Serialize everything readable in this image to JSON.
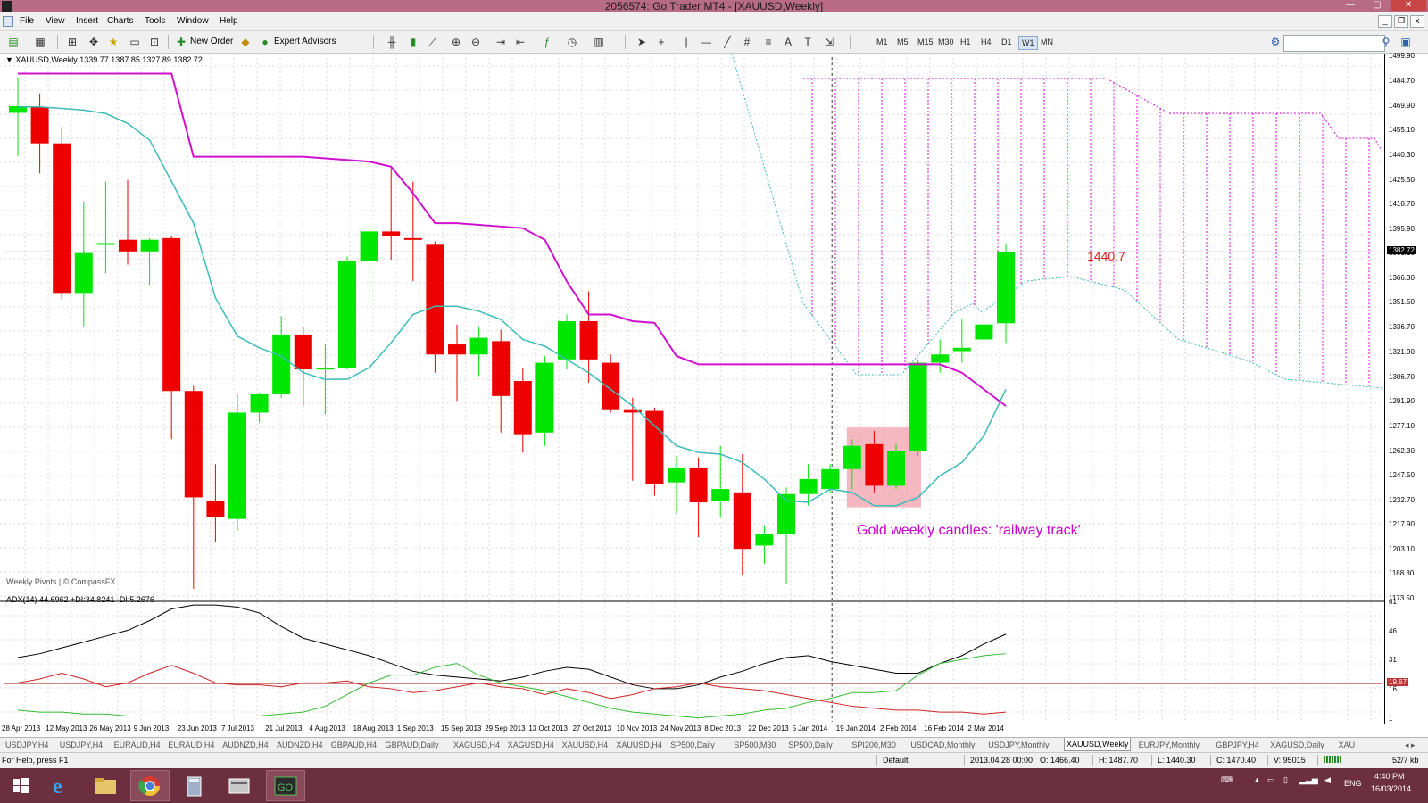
{
  "window": {
    "title": "2056574: Go Trader MT4 - [XAUUSD,Weekly]",
    "min_label": "—",
    "max_label": "▢",
    "close_label": "✕"
  },
  "menu": [
    "File",
    "View",
    "Insert",
    "Charts",
    "Tools",
    "Window",
    "Help"
  ],
  "toolbar": {
    "new_order": "New Order",
    "expert_advisors": "Expert Advisors",
    "timeframes": [
      "M1",
      "M5",
      "M15",
      "M30",
      "H1",
      "H4",
      "D1",
      "W1",
      "MN"
    ],
    "active_timeframe": "W1",
    "search_placeholder": ""
  },
  "chart": {
    "header": "XAUUSD,Weekly  1339.77 1387.85 1327.89 1382.72",
    "indicator_note": "Weekly Pivots | © CompassFX",
    "annotation": "Gold weekly candles: 'railway track'",
    "price_tag": "1440.7",
    "adx_header": "ADX(14) 44.6962 +DI:34.8241 -DI:5.2676",
    "current_price_label": "1382.72",
    "adx_current_label": "19.67"
  },
  "chart_data": {
    "type": "candlestick",
    "symbol": "XAUUSD",
    "timeframe": "Weekly",
    "ylim": [
      1173.5,
      1499.9
    ],
    "y_ticks": [
      "1499.90",
      "1484.70",
      "1469.90",
      "1455.10",
      "1440.30",
      "1425.50",
      "1410.70",
      "1395.90",
      "1381.10",
      "1366.30",
      "1351.50",
      "1336.70",
      "1321.90",
      "1306.70",
      "1291.90",
      "1277.10",
      "1262.30",
      "1247.50",
      "1232.70",
      "1217.90",
      "1203.10",
      "1188.30",
      "1173.50"
    ],
    "x_ticks": [
      "28 Apr 2013",
      "12 May 2013",
      "26 May 2013",
      "9 Jun 2013",
      "23 Jun 2013",
      "7 Jul 2013",
      "21 Jul 2013",
      "4 Aug 2013",
      "18 Aug 2013",
      "1 Sep 2013",
      "15 Sep 2013",
      "29 Sep 2013",
      "13 Oct 2013",
      "27 Oct 2013",
      "10 Nov 2013",
      "24 Nov 2013",
      "8 Dec 2013",
      "22 Dec 2013",
      "5 Jan 2014",
      "19 Jan 2014",
      "2 Feb 2014",
      "16 Feb 2014",
      "2 Mar 2014"
    ],
    "candles": [
      {
        "o": 1466.4,
        "h": 1487.7,
        "l": 1440.3,
        "c": 1470.4
      },
      {
        "o": 1469.9,
        "h": 1478.0,
        "l": 1430.0,
        "c": 1448.0
      },
      {
        "o": 1448.0,
        "h": 1458.0,
        "l": 1354.0,
        "c": 1358.0
      },
      {
        "o": 1358.0,
        "h": 1413.0,
        "l": 1338.0,
        "c": 1382.0
      },
      {
        "o": 1387.0,
        "h": 1425.0,
        "l": 1370.0,
        "c": 1388.0
      },
      {
        "o": 1390.0,
        "h": 1426.0,
        "l": 1375.0,
        "c": 1383.0
      },
      {
        "o": 1383.0,
        "h": 1391.0,
        "l": 1363.0,
        "c": 1390.0
      },
      {
        "o": 1391.0,
        "h": 1392.0,
        "l": 1270.0,
        "c": 1299.0
      },
      {
        "o": 1299.0,
        "h": 1302.0,
        "l": 1180.0,
        "c": 1235.0
      },
      {
        "o": 1233.0,
        "h": 1255.0,
        "l": 1208.0,
        "c": 1223.0
      },
      {
        "o": 1222.0,
        "h": 1297.0,
        "l": 1215.0,
        "c": 1286.0
      },
      {
        "o": 1286.0,
        "h": 1298.0,
        "l": 1280.0,
        "c": 1297.0
      },
      {
        "o": 1297.0,
        "h": 1344.0,
        "l": 1295.0,
        "c": 1333.0
      },
      {
        "o": 1333.0,
        "h": 1338.0,
        "l": 1290.0,
        "c": 1312.0
      },
      {
        "o": 1312.0,
        "h": 1327.0,
        "l": 1285.0,
        "c": 1313.0
      },
      {
        "o": 1313.0,
        "h": 1380.0,
        "l": 1312.0,
        "c": 1377.0
      },
      {
        "o": 1377.0,
        "h": 1400.0,
        "l": 1352.0,
        "c": 1395.0
      },
      {
        "o": 1395.0,
        "h": 1433.0,
        "l": 1378.0,
        "c": 1392.0
      },
      {
        "o": 1391.0,
        "h": 1425.0,
        "l": 1365.0,
        "c": 1390.0
      },
      {
        "o": 1387.0,
        "h": 1389.0,
        "l": 1310.0,
        "c": 1321.0
      },
      {
        "o": 1327.0,
        "h": 1339.0,
        "l": 1293.0,
        "c": 1321.0
      },
      {
        "o": 1321.0,
        "h": 1338.0,
        "l": 1308.0,
        "c": 1331.0
      },
      {
        "o": 1329.0,
        "h": 1336.0,
        "l": 1274.0,
        "c": 1296.0
      },
      {
        "o": 1305.0,
        "h": 1313.0,
        "l": 1262.0,
        "c": 1273.0
      },
      {
        "o": 1274.0,
        "h": 1320.0,
        "l": 1266.0,
        "c": 1316.0
      },
      {
        "o": 1318.0,
        "h": 1345.0,
        "l": 1312.0,
        "c": 1341.0
      },
      {
        "o": 1341.0,
        "h": 1359.0,
        "l": 1304.0,
        "c": 1318.0
      },
      {
        "o": 1316.0,
        "h": 1321.0,
        "l": 1286.0,
        "c": 1288.0
      },
      {
        "o": 1288.0,
        "h": 1295.0,
        "l": 1245.0,
        "c": 1286.0
      },
      {
        "o": 1287.0,
        "h": 1289.0,
        "l": 1236.0,
        "c": 1243.0
      },
      {
        "o": 1244.0,
        "h": 1260.0,
        "l": 1225.0,
        "c": 1253.0
      },
      {
        "o": 1253.0,
        "h": 1259.0,
        "l": 1211.0,
        "c": 1232.0
      },
      {
        "o": 1233.0,
        "h": 1266.0,
        "l": 1223.0,
        "c": 1240.0
      },
      {
        "o": 1238.0,
        "h": 1261.0,
        "l": 1188.0,
        "c": 1204.0
      },
      {
        "o": 1206.0,
        "h": 1218.0,
        "l": 1195.0,
        "c": 1213.0
      },
      {
        "o": 1213.0,
        "h": 1241.0,
        "l": 1183.0,
        "c": 1237.0
      },
      {
        "o": 1237.0,
        "h": 1255.0,
        "l": 1230.0,
        "c": 1246.0
      },
      {
        "o": 1240.0,
        "h": 1255.0,
        "l": 1238.0,
        "c": 1252.0
      },
      {
        "o": 1252.0,
        "h": 1270.0,
        "l": 1240.0,
        "c": 1266.0
      },
      {
        "o": 1267.0,
        "h": 1275.0,
        "l": 1238.0,
        "c": 1242.0
      },
      {
        "o": 1242.0,
        "h": 1267.0,
        "l": 1240.0,
        "c": 1263.0
      },
      {
        "o": 1263.0,
        "h": 1318.0,
        "l": 1260.0,
        "c": 1316.0
      },
      {
        "o": 1316.0,
        "h": 1330.0,
        "l": 1310.0,
        "c": 1321.0
      },
      {
        "o": 1323.0,
        "h": 1342.0,
        "l": 1316.0,
        "c": 1325.0
      },
      {
        "o": 1330.0,
        "h": 1346.0,
        "l": 1326.0,
        "c": 1339.0
      },
      {
        "o": 1339.77,
        "h": 1387.85,
        "l": 1327.89,
        "c": 1382.72
      }
    ],
    "tenkan": [
      1470,
      1470,
      1469,
      1468,
      1466,
      1460,
      1450,
      1425,
      1400,
      1355,
      1332,
      1325,
      1320,
      1310,
      1306,
      1306,
      1313,
      1328,
      1345,
      1350,
      1350,
      1347,
      1342,
      1330,
      1326,
      1318,
      1310,
      1300,
      1290,
      1278,
      1266,
      1262,
      1261,
      1256,
      1246,
      1233,
      1232,
      1240,
      1238,
      1230,
      1230,
      1235,
      1248,
      1256,
      1272,
      1300
    ],
    "kijun": [
      1490,
      1490,
      1490,
      1490,
      1490,
      1490,
      1490,
      1490,
      1440,
      1440,
      1440,
      1440,
      1440,
      1440,
      1439,
      1438,
      1437,
      1434,
      1418,
      1400,
      1400,
      1399,
      1398,
      1397,
      1390,
      1365,
      1345,
      1345,
      1341,
      1340,
      1320,
      1315,
      1315,
      1315,
      1315,
      1315,
      1315,
      1315,
      1315,
      1315,
      1315,
      1315,
      1315,
      1310,
      1300,
      1290
    ],
    "adx": {
      "ylim": [
        0,
        61
      ],
      "y_ticks": [
        "61",
        "46",
        "31",
        "16",
        "1"
      ],
      "adx": [
        33,
        35,
        38,
        41,
        44,
        47,
        52,
        58,
        60,
        60,
        59,
        56,
        49,
        43,
        40,
        37,
        34,
        30,
        26,
        24,
        23,
        22,
        21,
        23,
        26,
        28,
        27,
        23,
        19,
        17,
        17,
        19,
        23,
        26,
        30,
        33,
        34,
        31,
        29,
        27,
        25,
        25,
        30,
        34,
        40,
        45
      ],
      "plus_di": [
        6,
        5,
        5,
        4,
        4,
        3,
        3,
        3,
        3,
        3,
        3,
        3,
        4,
        5,
        8,
        14,
        20,
        24,
        24,
        28,
        30,
        24,
        20,
        18,
        16,
        13,
        10,
        7,
        5,
        4,
        3,
        2,
        3,
        4,
        6,
        7,
        10,
        12,
        15,
        15,
        16,
        24,
        30,
        32,
        34,
        35
      ],
      "minus_di": [
        20,
        22,
        25,
        22,
        18,
        20,
        25,
        29,
        25,
        20,
        19,
        19,
        18,
        20,
        20,
        21,
        18,
        17,
        15,
        16,
        18,
        20,
        18,
        17,
        14,
        17,
        15,
        12,
        14,
        17,
        18,
        20,
        18,
        17,
        16,
        14,
        12,
        10,
        8,
        7,
        6,
        6,
        5,
        5,
        4,
        5
      ],
      "level_line": 19.67
    }
  },
  "tabs": [
    "USDJPY,H4",
    "USDJPY,H4",
    "EURAUD,H4",
    "EURAUD,H4",
    "AUDNZD,H4",
    "AUDNZD,H4",
    "GBPAUD,H4",
    "GBPAUD,Daily",
    "XAGUSD,H4",
    "XAGUSD,H4",
    "XAUUSD,H4",
    "XAUUSD,H4",
    "SP500,Daily",
    "SP500,M30",
    "SP500,Daily",
    "SPI200,M30",
    "USDCAD,Monthly",
    "USDJPY,Monthly",
    "XAUUSD,Weekly",
    "EURJPY,Monthly",
    "GBPJPY,H4",
    "XAGUSD,Daily",
    "XAU"
  ],
  "active_tab_index": 18,
  "status": {
    "help": "For Help, press F1",
    "profile": "Default",
    "datetime": "2013.04.28 00:00",
    "open": "O: 1466.40",
    "high": "H: 1487.70",
    "low": "L: 1440.30",
    "close": "C: 1470.40",
    "volume": "V: 95015",
    "traffic": "52/7 kb"
  },
  "taskbar": {
    "language": "ENG",
    "time": "4:40 PM",
    "date": "16/03/2014"
  },
  "colors": {
    "bull": "#00e600",
    "bear": "#ee0000",
    "tenkan": "#3bbcb8",
    "kijun": "#d010d0",
    "cloud": "#d010d0",
    "annotation": "#cc00cc",
    "highlight": "#f2a0ac",
    "adx": "#000000",
    "plus_di": "#33bb33",
    "minus_di": "#cc2222"
  }
}
